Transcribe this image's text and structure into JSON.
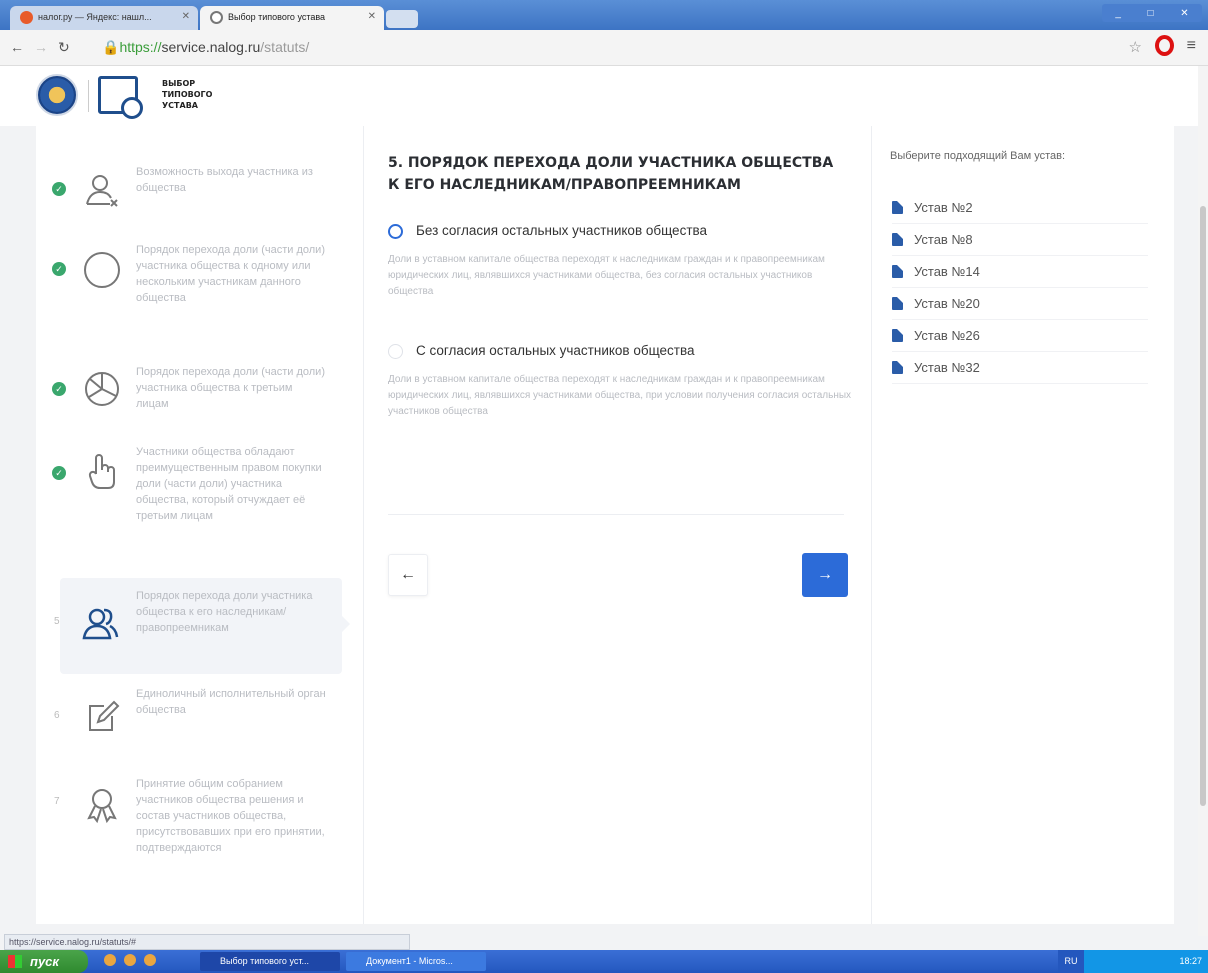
{
  "browser": {
    "tabs": [
      {
        "title": "налог.ру — Яндекс: нашл..."
      },
      {
        "title": "Выбор типового устава"
      }
    ],
    "url_scheme": "https://",
    "url_host": "service.nalog.ru",
    "url_path": "/statuts/",
    "status_url": "https://service.nalog.ru/statuts/#"
  },
  "header": {
    "logo_line1": "ВЫБОР",
    "logo_line2": "ТИПОВОГО",
    "logo_line3": "УСТАВА"
  },
  "steps": [
    {
      "number": "",
      "icon": "user-x-icon",
      "text": "Возможность выхода участника из общества",
      "done": true
    },
    {
      "number": "",
      "icon": "circle-icon",
      "text": "Порядок перехода доли (части доли) участника общества к одному или нескольким участникам данного общества",
      "done": true
    },
    {
      "number": "",
      "icon": "pie-chart-icon",
      "text": "Порядок перехода доли (части доли) участника общества к третьим лицам",
      "done": true
    },
    {
      "number": "",
      "icon": "hand-pointer-icon",
      "text": "Участники общества обладают преимущественным правом покупки доли (части доли) участника общества, который отчуждает её третьим лицам",
      "done": true
    },
    {
      "number": "5",
      "icon": "users-icon",
      "text": "Порядок перехода доли участника общества к его наследникам/ правопреемникам",
      "done": false,
      "active": true
    },
    {
      "number": "6",
      "icon": "edit-icon",
      "text": "Единоличный исполнительный орган общества",
      "done": false
    },
    {
      "number": "7",
      "icon": "award-icon",
      "text": "Принятие общим собранием участников общества решения и состав участников общества, присутствовавших при его принятии, подтверждаются",
      "done": false
    }
  ],
  "question": {
    "title": "5. ПОРЯДОК ПЕРЕХОДА ДОЛИ УЧАСТНИКА ОБЩЕСТВА К ЕГО НАСЛЕДНИКАМ/ПРАВОПРЕЕМНИКАМ",
    "options": [
      {
        "label": "Без согласия остальных участников общества",
        "description": "Доли в уставном капитале общества переходят к наследникам граждан и к правопреемникам юридических лиц, являвшихся участниками общества, без согласия остальных участников общества",
        "selected": true
      },
      {
        "label": "С согласия остальных участников общества",
        "description": "Доли в уставном капитале общества переходят к наследникам граждан и к правопреемникам юридических лиц, являвшихся участниками общества, при условии получения согласия остальных участников общества",
        "selected": false
      }
    ],
    "back_icon": "arrow-left-icon",
    "next_icon": "arrow-right-icon"
  },
  "ustav_panel": {
    "label": "Выберите подходящий Вам устав:",
    "items": [
      "Устав №2",
      "Устав №8",
      "Устав №14",
      "Устав №20",
      "Устав №26",
      "Устав №32"
    ]
  },
  "taskbar": {
    "start_label": "пуск",
    "tasks": [
      "Выбор типового уст...",
      "Документ1 - Micros..."
    ],
    "lang": "RU",
    "clock": "18:27"
  },
  "colors": {
    "accent": "#2c6bd8",
    "done": "#3aa76d"
  }
}
